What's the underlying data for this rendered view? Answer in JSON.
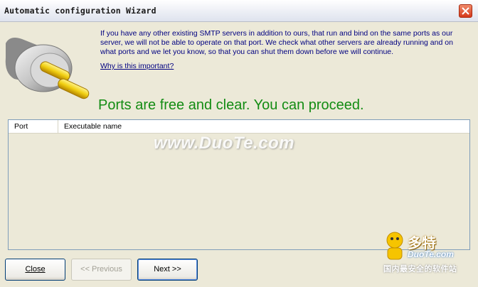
{
  "window": {
    "title": "Automatic configuration Wizard"
  },
  "intro": {
    "text": "If you have any other existing SMTP servers in addition to ours, that run and bind on the same ports as our server, we will not be able to operate on that port. We check what other servers are already running and on what ports and we let you know, so that you can shut them down before we will continue.",
    "link": "Why is this important?"
  },
  "status": {
    "text": "Ports are free and clear. You can proceed.",
    "color": "#138c13"
  },
  "listview": {
    "columns": [
      "Port",
      "Executable name"
    ],
    "rows": []
  },
  "watermark": {
    "text": "www.DuoTe.com"
  },
  "buttons": {
    "close": "Close",
    "previous": "<< Previous",
    "next": "Next >>"
  },
  "logo": {
    "line1": "多特",
    "line2": "DuoTe.com",
    "line3": "国内最安全的软件站"
  },
  "icons": {
    "plug": "plug-icon",
    "close": "close-icon"
  }
}
